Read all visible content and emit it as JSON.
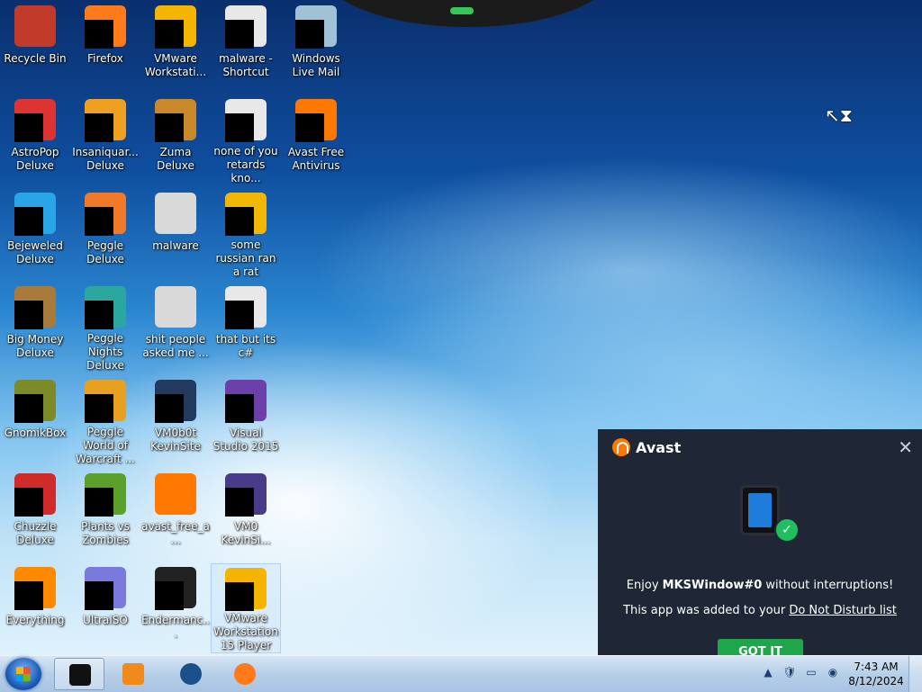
{
  "desktop": {
    "icons": [
      {
        "label": "Recycle Bin",
        "color": "#c23a2a",
        "masked": false
      },
      {
        "label": "Firefox",
        "color": "#ff7a1a",
        "masked": true
      },
      {
        "label": "VMware Workstati...",
        "color": "#f4b400",
        "masked": true
      },
      {
        "label": "malware - Shortcut",
        "color": "#e8e8e8",
        "masked": true
      },
      {
        "label": "Windows Live Mail",
        "color": "#9fc2d6",
        "masked": true
      },
      {
        "label": "AstroPop Deluxe",
        "color": "#d33",
        "masked": true
      },
      {
        "label": "Insaniquar... Deluxe",
        "color": "#f0a020",
        "masked": true
      },
      {
        "label": "Zuma Deluxe",
        "color": "#c9892b",
        "masked": true
      },
      {
        "label": "none of you retards kno...",
        "color": "#e8e8e8",
        "masked": true
      },
      {
        "label": "Avast Free Antivirus",
        "color": "#ff7800",
        "masked": true
      },
      {
        "label": "Bejeweled Deluxe",
        "color": "#29a6e8",
        "masked": true
      },
      {
        "label": "Peggle Deluxe",
        "color": "#f07a2a",
        "masked": true
      },
      {
        "label": "malware",
        "color": "#d9d9d9",
        "masked": false
      },
      {
        "label": "some russian ran a rat",
        "color": "#f2b705",
        "masked": true
      },
      {
        "label": "Big Money Deluxe",
        "color": "#a87b3c",
        "masked": true
      },
      {
        "label": "Peggle Nights Deluxe",
        "color": "#2aa8a0",
        "masked": true
      },
      {
        "label": "shit people asked me ...",
        "color": "#d9d9d9",
        "masked": false
      },
      {
        "label": "that but its c#",
        "color": "#e8e8e8",
        "masked": true
      },
      {
        "label": "GnomikBox",
        "color": "#7d8a2a",
        "masked": true
      },
      {
        "label": "Peggle World of Warcraft ...",
        "color": "#e8a020",
        "masked": true
      },
      {
        "label": "VM0b0t KevinSite",
        "color": "#223a5e",
        "masked": true
      },
      {
        "label": "Visual Studio 2015",
        "color": "#6d3fa8",
        "masked": true
      },
      {
        "label": "Chuzzle Deluxe",
        "color": "#d02a2a",
        "masked": true
      },
      {
        "label": "Plants vs Zombies",
        "color": "#5aa02a",
        "masked": true
      },
      {
        "label": "avast_free_a...",
        "color": "#ff7800",
        "masked": false
      },
      {
        "label": "VM0 KevinSi...",
        "color": "#4a3a8a",
        "masked": true
      },
      {
        "label": "Everything",
        "color": "#ff8a00",
        "masked": true
      },
      {
        "label": "UltraISO",
        "color": "#7a7adc",
        "masked": true
      },
      {
        "label": "Endermanc...",
        "color": "#222",
        "masked": true
      },
      {
        "label": "VMware Workstation 15 Player",
        "color": "#f4b400",
        "masked": true,
        "selected": true
      }
    ]
  },
  "avast_popup": {
    "brand": "Avast",
    "message_prefix": "Enjoy ",
    "app_name": "MKSWindow#0",
    "message_suffix": " without interruptions!",
    "added_text": "This app was added to your ",
    "dnd_link": "Do Not Disturb list",
    "button": "GOT IT",
    "accent": "#ff7800",
    "button_color": "#1fa64a"
  },
  "taskbar": {
    "items": [
      {
        "name": "taskbar-vm-app",
        "color": "#111",
        "active": true
      },
      {
        "name": "taskbar-media-player",
        "color": "#f08a1a",
        "active": false
      },
      {
        "name": "taskbar-globe",
        "color": "#1b4f8a",
        "active": false
      },
      {
        "name": "taskbar-firefox",
        "color": "#ff7a1a",
        "active": false
      }
    ],
    "tray_icons": [
      "▲",
      "🛡",
      "▭",
      "◉"
    ],
    "time": "7:43 AM",
    "date": "8/12/2024"
  }
}
